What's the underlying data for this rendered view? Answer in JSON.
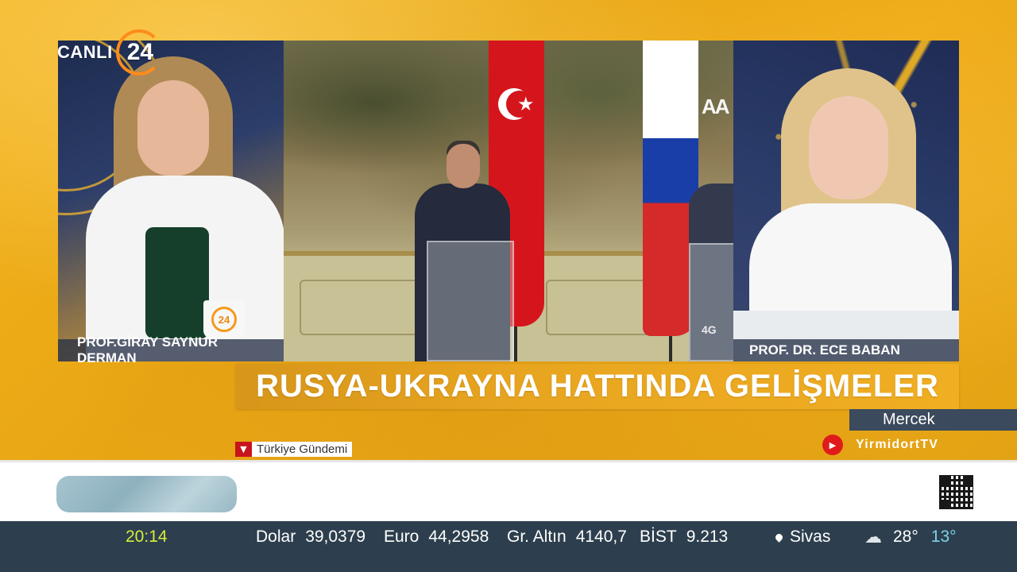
{
  "logo": {
    "text": "CANLI",
    "number": "24"
  },
  "panels": {
    "left": {
      "name": "PROF.GİRAY SAYNUR DERMAN",
      "mug_logo": "24"
    },
    "center": {
      "watermark": "AA",
      "tag": "4G"
    },
    "right": {
      "name": "PROF. DR. ECE BABAN"
    }
  },
  "headline": "RUSYA-UKRAYNA HATTINDA GELİŞMELER",
  "program": "Mercek",
  "youtube": {
    "icon": "youtube-icon",
    "channel": "YirmidortTV"
  },
  "section": "Türkiye Gündemi",
  "ticker": {
    "time": "20:14",
    "items": [
      {
        "label": "Dolar",
        "value": "39,0379"
      },
      {
        "label": "Euro",
        "value": "44,2958"
      },
      {
        "label": "Gr. Altın",
        "value": "4140,7"
      },
      {
        "label": "BİST",
        "value": "9.213"
      }
    ],
    "city": "Sivas",
    "weather_icon": "rain-cloud-icon",
    "temp_high": "28°",
    "temp_low": "13°"
  },
  "colors": {
    "brand_orange": "#f0ad1a",
    "ticker_bg": "#2d3f4e",
    "time_color": "#d7ec3c",
    "low_temp_color": "#7ed3e6",
    "accent_red": "#c8141c"
  }
}
